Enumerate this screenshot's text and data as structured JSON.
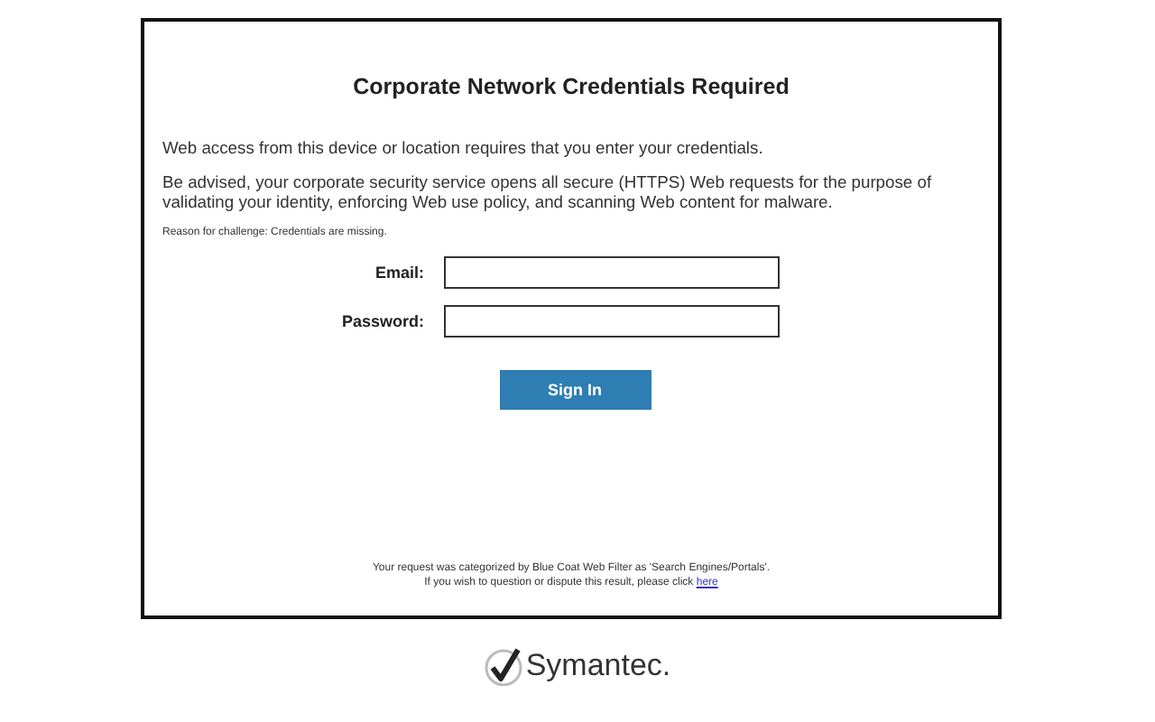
{
  "title": "Corporate Network Credentials Required",
  "paragraphs": [
    "Web access from this device or location requires that you enter your credentials.",
    "Be advised, your corporate security service opens all secure (HTTPS) Web requests for the purpose of validating your identity, enforcing Web use policy, and scanning Web content for malware."
  ],
  "reason": "Reason for challenge: Credentials are missing.",
  "fields": [
    {
      "label": "Email:"
    },
    {
      "label": "Password:"
    }
  ],
  "button": "Sign In",
  "footer": {
    "line1": "Your request was categorized by Blue Coat Web Filter as 'Search Engines/Portals'.",
    "line2": "If you wish to question or dispute this result, please click ",
    "link": "here"
  },
  "logo": "Symantec."
}
